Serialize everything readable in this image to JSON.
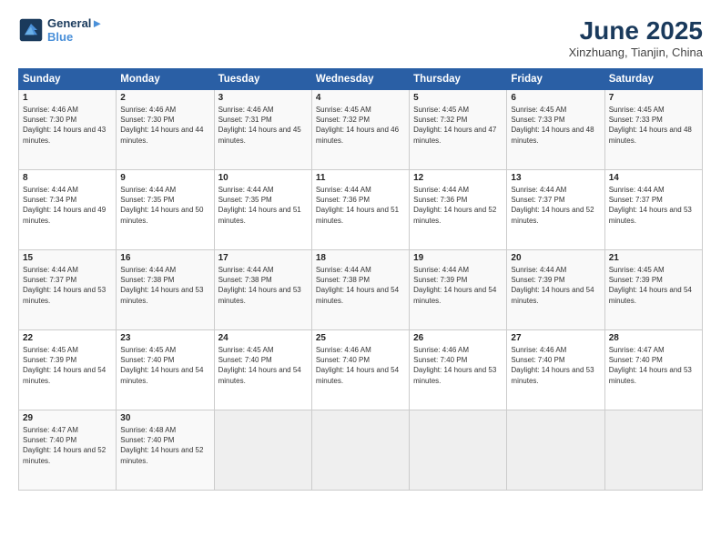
{
  "header": {
    "logo_line1": "General",
    "logo_line2": "Blue",
    "title": "June 2025",
    "subtitle": "Xinzhuang, Tianjin, China"
  },
  "days_of_week": [
    "Sunday",
    "Monday",
    "Tuesday",
    "Wednesday",
    "Thursday",
    "Friday",
    "Saturday"
  ],
  "weeks": [
    [
      {
        "num": "1",
        "rise": "4:46 AM",
        "set": "7:30 PM",
        "daylight": "14 hours and 43 minutes."
      },
      {
        "num": "2",
        "rise": "4:46 AM",
        "set": "7:30 PM",
        "daylight": "14 hours and 44 minutes."
      },
      {
        "num": "3",
        "rise": "4:46 AM",
        "set": "7:31 PM",
        "daylight": "14 hours and 45 minutes."
      },
      {
        "num": "4",
        "rise": "4:45 AM",
        "set": "7:32 PM",
        "daylight": "14 hours and 46 minutes."
      },
      {
        "num": "5",
        "rise": "4:45 AM",
        "set": "7:32 PM",
        "daylight": "14 hours and 47 minutes."
      },
      {
        "num": "6",
        "rise": "4:45 AM",
        "set": "7:33 PM",
        "daylight": "14 hours and 48 minutes."
      },
      {
        "num": "7",
        "rise": "4:45 AM",
        "set": "7:33 PM",
        "daylight": "14 hours and 48 minutes."
      }
    ],
    [
      {
        "num": "8",
        "rise": "4:44 AM",
        "set": "7:34 PM",
        "daylight": "14 hours and 49 minutes."
      },
      {
        "num": "9",
        "rise": "4:44 AM",
        "set": "7:35 PM",
        "daylight": "14 hours and 50 minutes."
      },
      {
        "num": "10",
        "rise": "4:44 AM",
        "set": "7:35 PM",
        "daylight": "14 hours and 51 minutes."
      },
      {
        "num": "11",
        "rise": "4:44 AM",
        "set": "7:36 PM",
        "daylight": "14 hours and 51 minutes."
      },
      {
        "num": "12",
        "rise": "4:44 AM",
        "set": "7:36 PM",
        "daylight": "14 hours and 52 minutes."
      },
      {
        "num": "13",
        "rise": "4:44 AM",
        "set": "7:37 PM",
        "daylight": "14 hours and 52 minutes."
      },
      {
        "num": "14",
        "rise": "4:44 AM",
        "set": "7:37 PM",
        "daylight": "14 hours and 53 minutes."
      }
    ],
    [
      {
        "num": "15",
        "rise": "4:44 AM",
        "set": "7:37 PM",
        "daylight": "14 hours and 53 minutes."
      },
      {
        "num": "16",
        "rise": "4:44 AM",
        "set": "7:38 PM",
        "daylight": "14 hours and 53 minutes."
      },
      {
        "num": "17",
        "rise": "4:44 AM",
        "set": "7:38 PM",
        "daylight": "14 hours and 53 minutes."
      },
      {
        "num": "18",
        "rise": "4:44 AM",
        "set": "7:38 PM",
        "daylight": "14 hours and 54 minutes."
      },
      {
        "num": "19",
        "rise": "4:44 AM",
        "set": "7:39 PM",
        "daylight": "14 hours and 54 minutes."
      },
      {
        "num": "20",
        "rise": "4:44 AM",
        "set": "7:39 PM",
        "daylight": "14 hours and 54 minutes."
      },
      {
        "num": "21",
        "rise": "4:45 AM",
        "set": "7:39 PM",
        "daylight": "14 hours and 54 minutes."
      }
    ],
    [
      {
        "num": "22",
        "rise": "4:45 AM",
        "set": "7:39 PM",
        "daylight": "14 hours and 54 minutes."
      },
      {
        "num": "23",
        "rise": "4:45 AM",
        "set": "7:40 PM",
        "daylight": "14 hours and 54 minutes."
      },
      {
        "num": "24",
        "rise": "4:45 AM",
        "set": "7:40 PM",
        "daylight": "14 hours and 54 minutes."
      },
      {
        "num": "25",
        "rise": "4:46 AM",
        "set": "7:40 PM",
        "daylight": "14 hours and 54 minutes."
      },
      {
        "num": "26",
        "rise": "4:46 AM",
        "set": "7:40 PM",
        "daylight": "14 hours and 53 minutes."
      },
      {
        "num": "27",
        "rise": "4:46 AM",
        "set": "7:40 PM",
        "daylight": "14 hours and 53 minutes."
      },
      {
        "num": "28",
        "rise": "4:47 AM",
        "set": "7:40 PM",
        "daylight": "14 hours and 53 minutes."
      }
    ],
    [
      {
        "num": "29",
        "rise": "4:47 AM",
        "set": "7:40 PM",
        "daylight": "14 hours and 52 minutes."
      },
      {
        "num": "30",
        "rise": "4:48 AM",
        "set": "7:40 PM",
        "daylight": "14 hours and 52 minutes."
      },
      null,
      null,
      null,
      null,
      null
    ]
  ],
  "labels": {
    "sunrise": "Sunrise:",
    "sunset": "Sunset:",
    "daylight": "Daylight:"
  }
}
